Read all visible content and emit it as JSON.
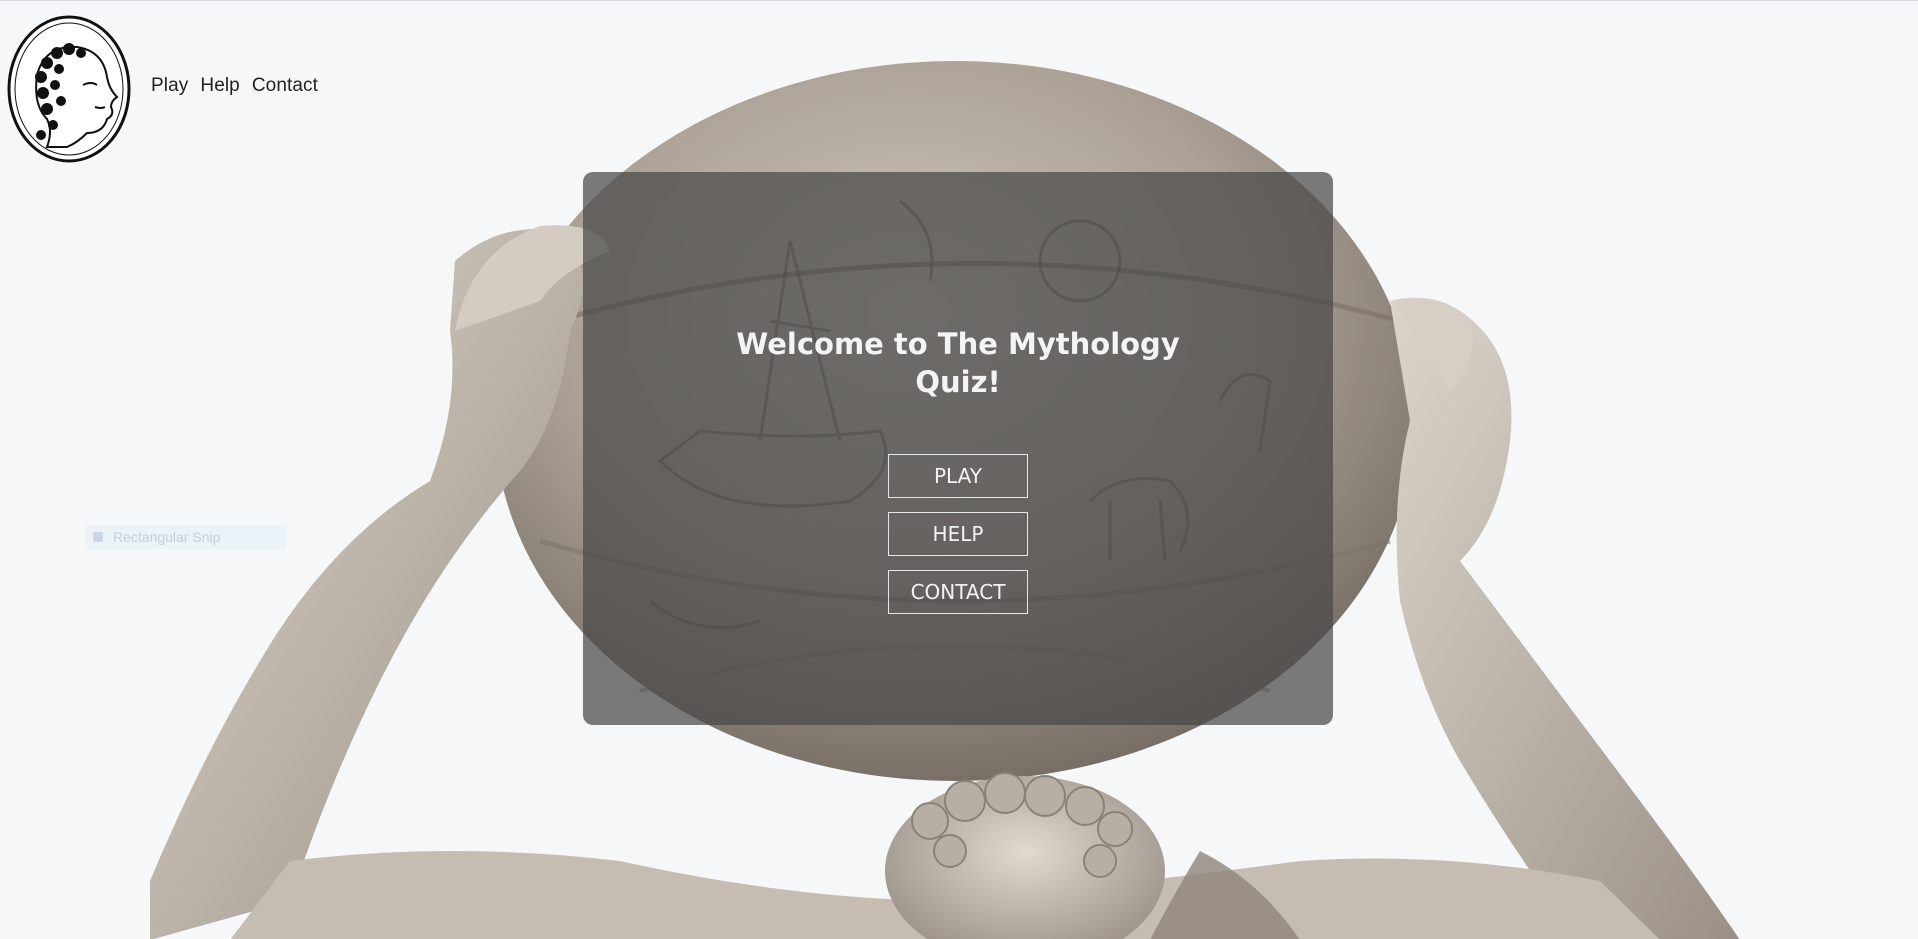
{
  "logo": {
    "icon": "medusa-medallion-logo"
  },
  "nav": {
    "play": "Play",
    "help": "Help",
    "contact": "Contact"
  },
  "hero": {
    "title_line1": "Welcome to The Mythology",
    "title_line2": "Quiz!",
    "buttons": {
      "play": "PLAY",
      "help": "HELP",
      "contact": "CONTACT"
    },
    "background_image": "atlas-statue-holding-celestial-globe"
  },
  "overlay_tooltip": {
    "label": "Rectangular Snip",
    "icon": "snip-icon"
  },
  "colors": {
    "page_bg": "#f6f7f9",
    "card_bg": "rgba(72,72,72,0.72)",
    "text_light": "#f4f4f4",
    "nav_text": "#222222"
  }
}
